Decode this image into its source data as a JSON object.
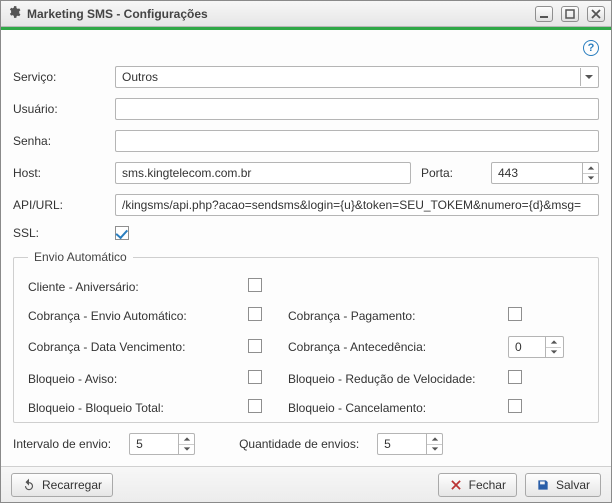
{
  "window": {
    "title": "Marketing SMS - Configurações"
  },
  "form": {
    "servico_label": "Serviço:",
    "servico_value": "Outros",
    "usuario_label": "Usuário:",
    "usuario_value": "",
    "senha_label": "Senha:",
    "senha_value": "",
    "host_label": "Host:",
    "host_value": "sms.kingtelecom.com.br",
    "porta_label": "Porta:",
    "porta_value": "443",
    "apiurl_label": "API/URL:",
    "apiurl_value": "/kingsms/api.php?acao=sendsms&login={u}&token=SEU_TOKEM&numero={d}&msg=",
    "ssl_label": "SSL:",
    "ssl_checked": true
  },
  "envio": {
    "legend": "Envio Automático",
    "cliente_aniversario_label": "Cliente - Aniversário:",
    "cobranca_envio_label": "Cobrança - Envio Automático:",
    "cobranca_pagamento_label": "Cobrança - Pagamento:",
    "cobranca_vencimento_label": "Cobrança - Data Vencimento:",
    "cobranca_antecedencia_label": "Cobrança - Antecedência:",
    "cobranca_antecedencia_value": "0",
    "bloqueio_aviso_label": "Bloqueio - Aviso:",
    "bloqueio_reducao_label": "Bloqueio - Redução de Velocidade:",
    "bloqueio_total_label": "Bloqueio - Bloqueio Total:",
    "bloqueio_cancelamento_label": "Bloqueio - Cancelamento:"
  },
  "bottom": {
    "intervalo_label": "Intervalo de envio:",
    "intervalo_value": "5",
    "quantidade_label": "Quantidade de envios:",
    "quantidade_value": "5"
  },
  "footer": {
    "recarregar": "Recarregar",
    "fechar": "Fechar",
    "salvar": "Salvar"
  }
}
